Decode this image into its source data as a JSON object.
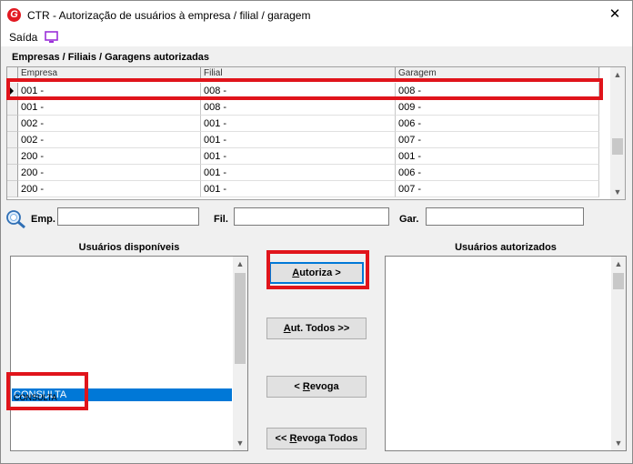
{
  "window": {
    "title": "CTR - Autorização de usuários à empresa / filial / garagem",
    "close_glyph": "✕",
    "app_icon_letter": "G"
  },
  "menu": {
    "saida_label": "Saída",
    "monitor_icon": "monitor-icon"
  },
  "grid": {
    "caption": "Empresas / Filiais / Garagens autorizadas",
    "columns": [
      "Empresa",
      "Filial",
      "Garagem"
    ],
    "rows": [
      {
        "empresa": "001 -",
        "filial": "008 -",
        "garagem": "008 -"
      },
      {
        "empresa": "001 -",
        "filial": "008 -",
        "garagem": "009 -"
      },
      {
        "empresa": "002 -",
        "filial": "001 -",
        "garagem": "006 -"
      },
      {
        "empresa": "002 -",
        "filial": "001 -",
        "garagem": "007 -"
      },
      {
        "empresa": "200 -",
        "filial": "001 -",
        "garagem": "001 -"
      },
      {
        "empresa": "200 -",
        "filial": "001 -",
        "garagem": "006 -"
      },
      {
        "empresa": "200 -",
        "filial": "001 -",
        "garagem": "007 -"
      }
    ]
  },
  "filters": {
    "emp_label": "Emp.",
    "fil_label": "Fil.",
    "gar_label": "Gar.",
    "emp_value": "",
    "fil_value": "",
    "gar_value": ""
  },
  "available": {
    "caption": "Usuários disponíveis",
    "selected_item": "CONSULTA",
    "partial_item": "CONSULTA"
  },
  "authorized": {
    "caption": "Usuários autorizados",
    "items": []
  },
  "buttons": {
    "autoriza": "Autoriza >",
    "aut_todos": "Aut. Todos >>",
    "revoga": "< Revoga",
    "revoga_todos": "<< Revoga Todos"
  },
  "colors": {
    "annotation_red": "#e0141b",
    "selection_blue": "#0078d7",
    "brand_red": "#e21a22"
  }
}
